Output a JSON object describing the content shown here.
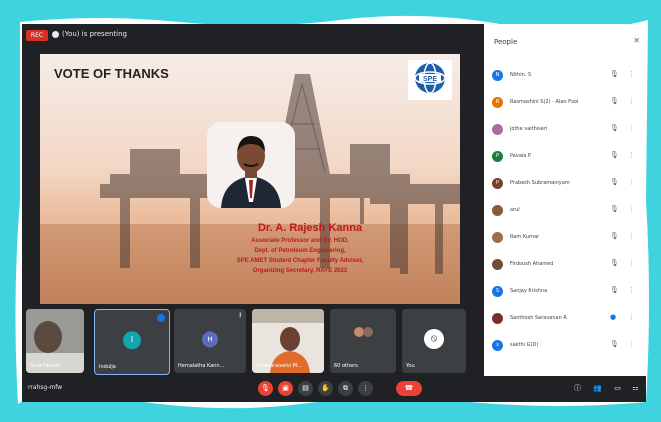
{
  "colors": {
    "frame": "#3fd3e0",
    "meet_bg": "#202124",
    "tile_bg": "#3c4043",
    "title_red": "#c0171c",
    "end_call": "#ea4335"
  },
  "topbar": {
    "rec_badge": "REC",
    "presenting_text": "(You) is presenting"
  },
  "slide": {
    "title": "VOTE OF THANKS",
    "logo_text": "SPE",
    "name": "Dr. A. Rajesh Kanna",
    "lines": [
      "Associate Professor and Dy. HOD,",
      "Dept. of Petroleum Engineering,",
      "SPE AMET Student Chapter Faculty Advisor,",
      "Organizing Secretary, RAYE 2022"
    ]
  },
  "people": {
    "title": "People",
    "close_icon": "close-icon",
    "rows": [
      {
        "name": "Nithin. S",
        "initial": "N",
        "color": "#1a73e8"
      },
      {
        "name": "Rasmashini S(2) - Alan Fool",
        "initial": "R",
        "color": "#e37400"
      },
      {
        "name": "jothe vaithiseri",
        "initial": "",
        "color": "#b06aa0"
      },
      {
        "name": "Pavala P",
        "initial": "P",
        "color": "#188038"
      },
      {
        "name": "Prabesh Subramaniyam",
        "initial": "P",
        "color": "#7b3f2a"
      },
      {
        "name": "arul",
        "initial": "",
        "color": "#8a5a3a"
      },
      {
        "name": "Ram Kumar",
        "initial": "",
        "color": "#a16c4a"
      },
      {
        "name": "Firdoush Ahamed",
        "initial": "",
        "color": "#6f4e37"
      },
      {
        "name": "Sanjay Krishna",
        "initial": "S",
        "color": "#1a73e8"
      },
      {
        "name": "Santhosh Saravanan R",
        "initial": "",
        "color": "#7a2e2e"
      },
      {
        "name": "sakthi G(D)",
        "initial": "s",
        "color": "#1a73e8"
      }
    ]
  },
  "tiles": [
    {
      "label": "Sura Fanush",
      "initial": ""
    },
    {
      "label": "Indulja",
      "initial": "I"
    },
    {
      "label": "Hemalatha Kann...",
      "initial": "H"
    },
    {
      "label": "Thamaraiselvi M...",
      "initial": ""
    },
    {
      "label": "60 others",
      "initial": ""
    },
    {
      "label": "You",
      "initial": ""
    }
  ],
  "bottombar": {
    "meeting_code": "rrahsg-mfw"
  }
}
